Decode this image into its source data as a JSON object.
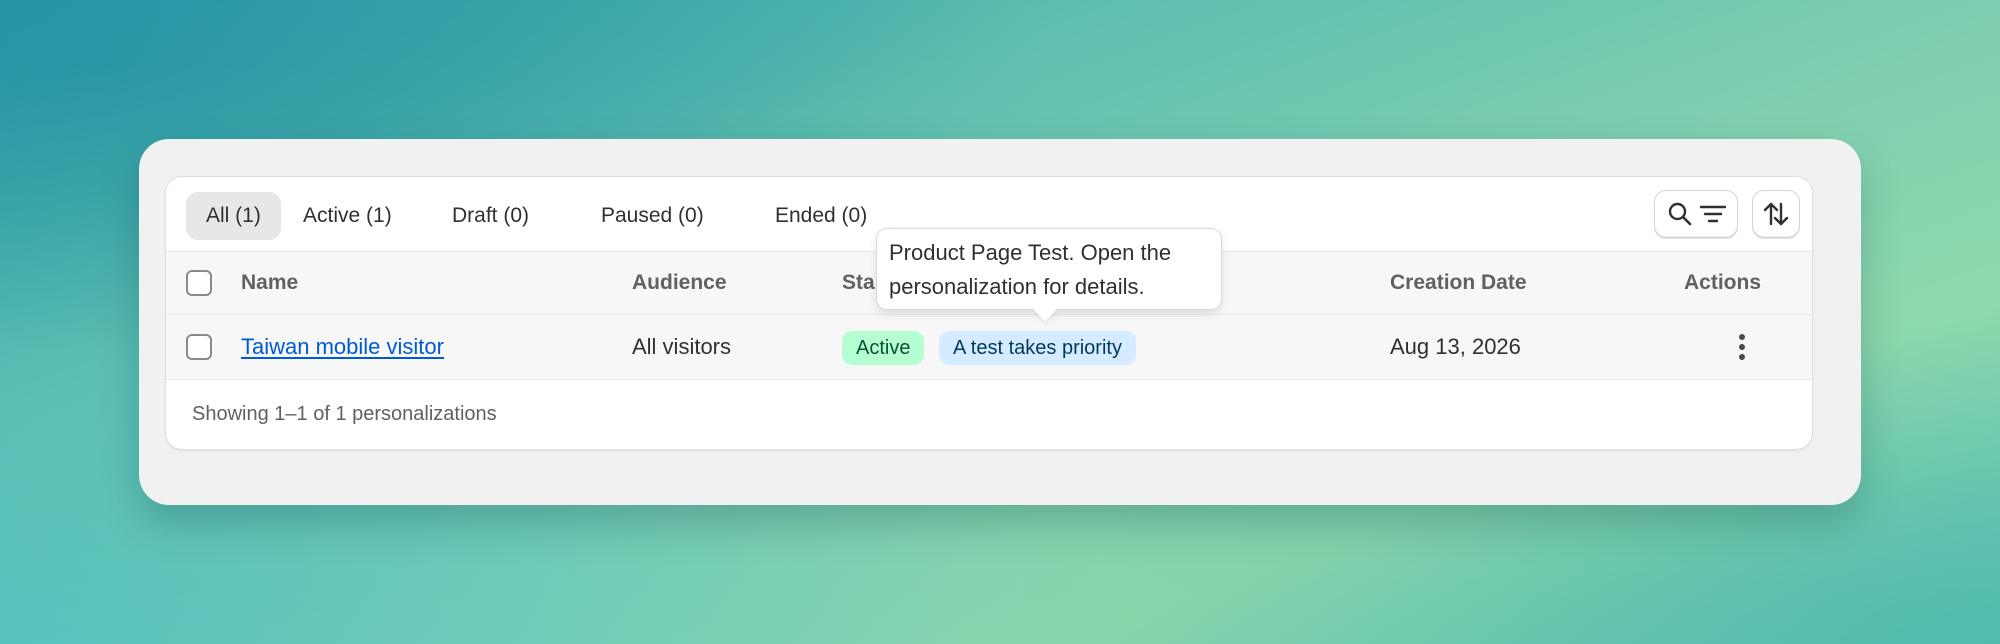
{
  "tabs": [
    {
      "label": "All (1)",
      "selected": true
    },
    {
      "label": "Active (1)",
      "selected": false
    },
    {
      "label": "Draft (0)",
      "selected": false
    },
    {
      "label": "Paused (0)",
      "selected": false
    },
    {
      "label": "Ended (0)",
      "selected": false
    }
  ],
  "toolbar": {
    "search_icon": "search-icon",
    "filter_icon": "filter-icon",
    "sort_icon": "sort-icon"
  },
  "table": {
    "headers": {
      "name": "Name",
      "audience": "Audience",
      "status": "Sta",
      "creation_date": "Creation Date",
      "actions": "Actions"
    },
    "rows": [
      {
        "name": "Taiwan mobile visitor",
        "audience": "All visitors",
        "status_badge": "Active",
        "info_badge": "A test takes priority",
        "creation_date": "Aug 13, 2026",
        "actions_icon": "more-vertical-icon"
      }
    ]
  },
  "footer": {
    "summary": "Showing 1–1 of 1 personalizations"
  },
  "tooltip": {
    "text": "Product Page Test. Open the personalization for details."
  },
  "colors": {
    "link": "#005bd3",
    "badge_active_bg": "#b4fed2",
    "badge_info_bg": "#d5ebff"
  }
}
